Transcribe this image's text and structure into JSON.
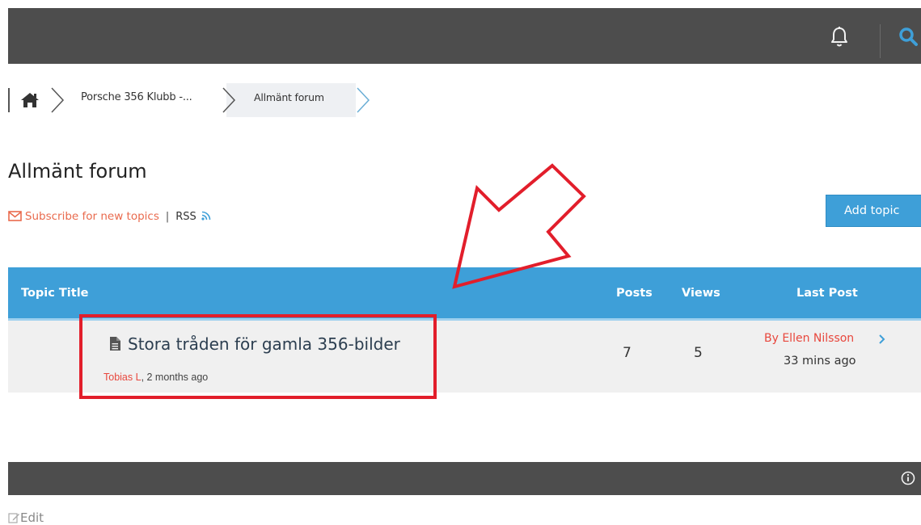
{
  "breadcrumb": {
    "items": [
      {
        "label": "Porsche 356 Klubb -..."
      },
      {
        "label": "Allmänt forum"
      }
    ]
  },
  "page": {
    "title": "Allmänt forum"
  },
  "actions": {
    "subscribe_label": "Subscribe for new topics",
    "separator": "|",
    "rss_label": "RSS",
    "add_topic_label": "Add topic"
  },
  "table": {
    "headers": {
      "topic_title": "Topic Title",
      "posts": "Posts",
      "views": "Views",
      "last_post": "Last Post"
    },
    "rows": [
      {
        "title": "Stora tråden för gamla 356-bilder",
        "author": "Tobias L",
        "created": ", 2 months ago",
        "posts": "7",
        "views": "5",
        "last_post_by": "By Ellen Nilsson",
        "last_post_time": "33 mins ago"
      }
    ]
  },
  "footer": {
    "edit_label": "Edit"
  },
  "colors": {
    "header_bar": "#4d4d4d",
    "accent_blue": "#3e9fd8",
    "link_orange": "#e96a4d",
    "author_red": "#e8473d",
    "annotation_red": "#e21e2b"
  },
  "icons": [
    "bell-icon",
    "search-icon",
    "home-icon",
    "envelope-icon",
    "rss-icon",
    "document-icon",
    "chevron-right-icon",
    "info-icon",
    "edit-icon"
  ]
}
